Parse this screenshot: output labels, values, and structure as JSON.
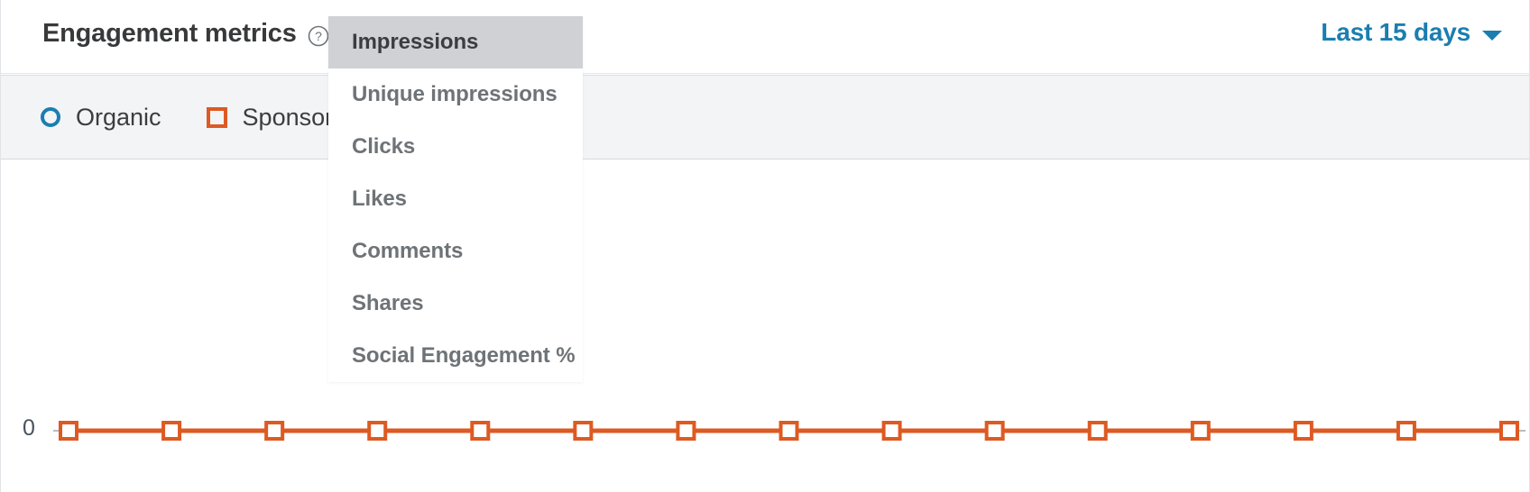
{
  "header": {
    "title": "Engagement metrics",
    "help_icon": "help-circle-icon",
    "date_range_label": "Last 15 days",
    "date_range_icon": "chevron-down-icon"
  },
  "legend": {
    "items": [
      {
        "label": "Organic",
        "marker": "circle",
        "color": "#1a7eb0"
      },
      {
        "label": "Sponsored",
        "marker": "square",
        "color": "#dd5a22"
      }
    ]
  },
  "dropdown": {
    "open": true,
    "selected": "Impressions",
    "items": [
      {
        "label": "Impressions",
        "selected": true
      },
      {
        "label": "Unique impressions",
        "selected": false
      },
      {
        "label": "Clicks",
        "selected": false
      },
      {
        "label": "Likes",
        "selected": false
      },
      {
        "label": "Comments",
        "selected": false
      },
      {
        "label": "Shares",
        "selected": false
      },
      {
        "label": "Social Engagement %",
        "selected": false
      }
    ]
  },
  "chart_data": {
    "type": "line",
    "title": "Engagement metrics",
    "xlabel": "",
    "ylabel": "",
    "ylim": [
      0,
      1
    ],
    "y_tick_labels": [
      "0"
    ],
    "grid": false,
    "legend_position": "top-left",
    "x": [
      1,
      2,
      3,
      4,
      5,
      6,
      7,
      8,
      9,
      10,
      11,
      12,
      13,
      14,
      15
    ],
    "series": [
      {
        "name": "Sponsored",
        "color": "#dd5a22",
        "marker": "square",
        "values": [
          0,
          0,
          0,
          0,
          0,
          0,
          0,
          0,
          0,
          0,
          0,
          0,
          0,
          0,
          0
        ]
      }
    ]
  }
}
